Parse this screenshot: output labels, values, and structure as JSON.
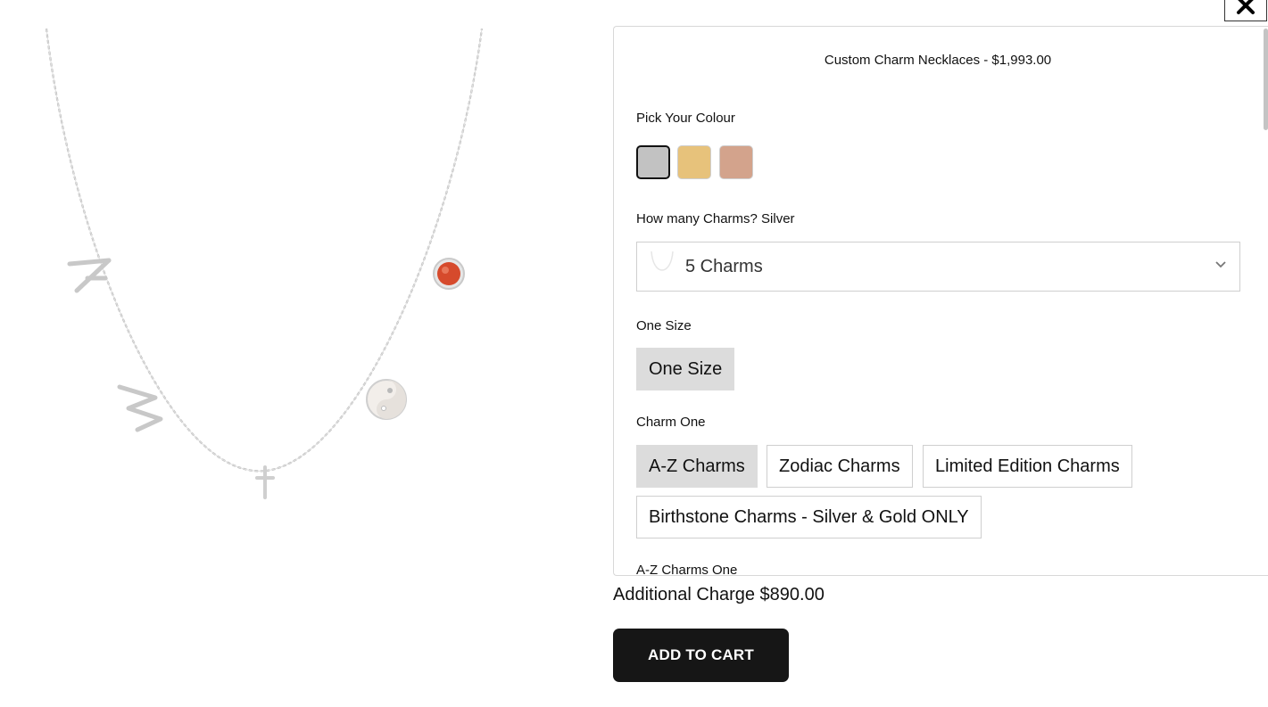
{
  "product": {
    "title": "Custom Charm Necklaces - $1,993.00"
  },
  "colour": {
    "label": "Pick Your Colour",
    "swatches": [
      {
        "name": "Silver",
        "color": "#c2c2c2",
        "selected": true
      },
      {
        "name": "Gold",
        "color": "#e7c27b",
        "selected": false
      },
      {
        "name": "Rose Gold",
        "color": "#d3a38c",
        "selected": false
      }
    ]
  },
  "charms_count": {
    "label": "How many Charms? Silver",
    "selected_value": "5 Charms"
  },
  "size": {
    "label": "One Size",
    "options": [
      "One Size"
    ]
  },
  "charm_one": {
    "label": "Charm One",
    "options": [
      "A-Z Charms",
      "Zodiac Charms",
      "Limited Edition Charms",
      "Birthstone Charms - Silver & Gold ONLY"
    ],
    "selected": "A-Z Charms"
  },
  "az_charms_one": {
    "label": "A-Z Charms One"
  },
  "footer": {
    "additional_charge": "Additional Charge $890.00",
    "add_to_cart_label": "ADD TO CART"
  },
  "icons": {
    "close": "close-icon",
    "chevron": "chevron-down-icon"
  }
}
